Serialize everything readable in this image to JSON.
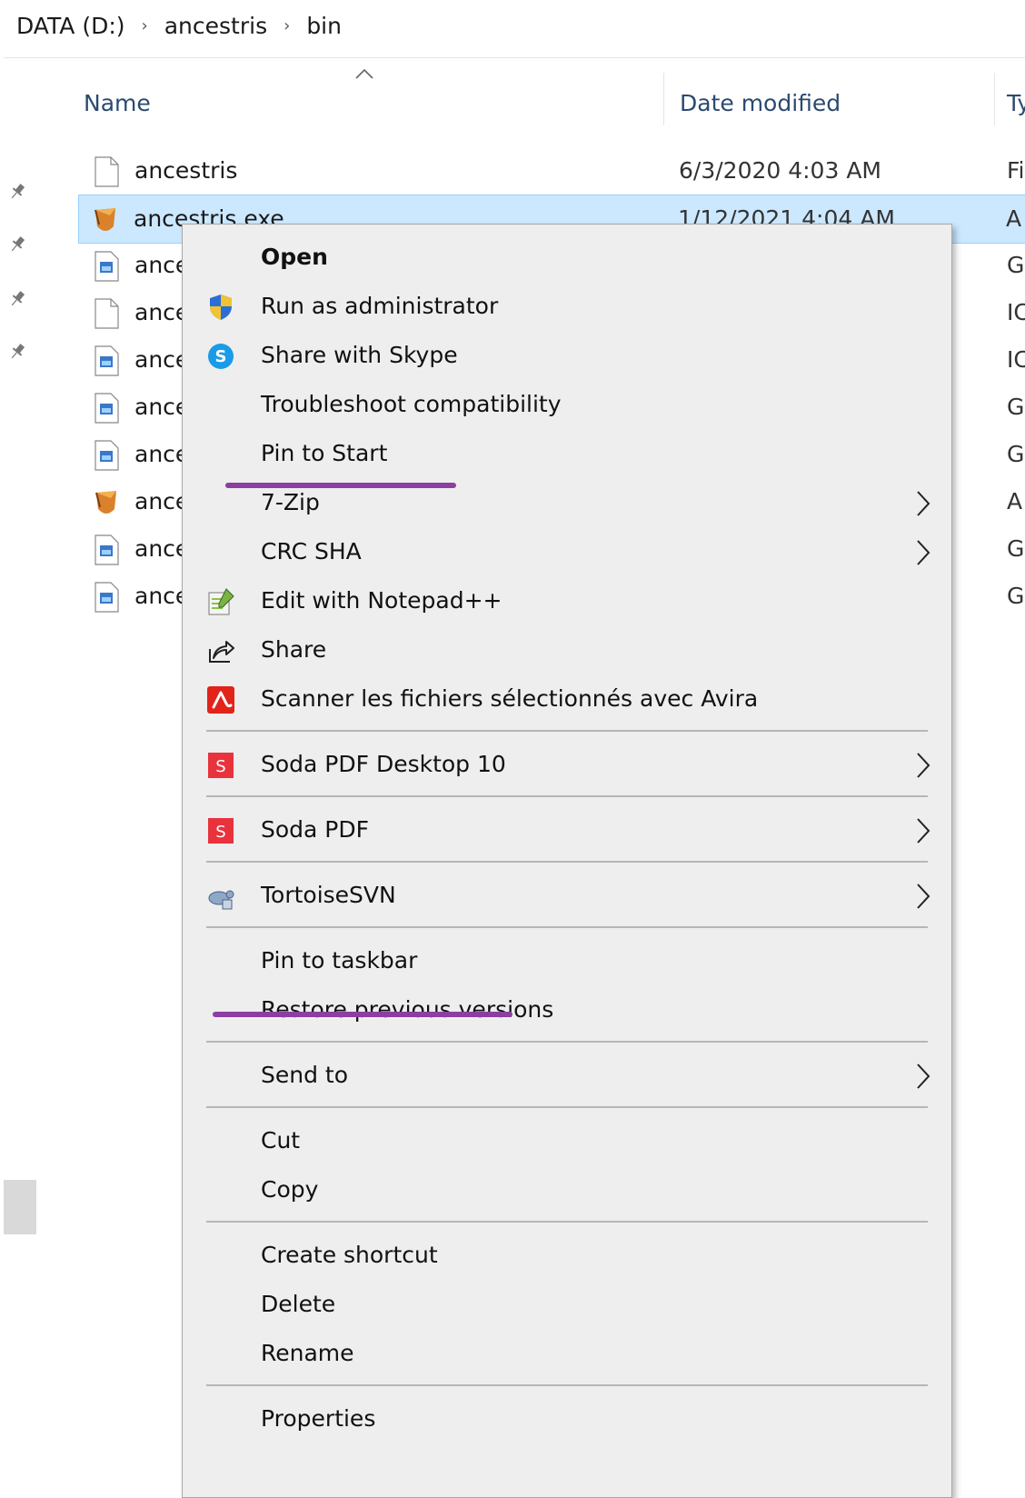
{
  "breadcrumb": [
    "DATA (D:)",
    "ancestris",
    "bin"
  ],
  "columns": {
    "name": "Name",
    "date_modified": "Date modified",
    "type": "Ty"
  },
  "files": [
    {
      "name": "ancestris",
      "date": "6/3/2020 4:03 AM",
      "type": "Fi",
      "icon": "blank-file-icon"
    },
    {
      "name": "ancestris.exe",
      "date": "1/12/2021 4:04 AM",
      "type": "A",
      "icon": "app-icon",
      "selected": true
    },
    {
      "name": "ance",
      "date": "",
      "type": "G",
      "icon": "image-file-icon"
    },
    {
      "name": "ance",
      "date": "",
      "type": "IC",
      "icon": "blank-file-icon"
    },
    {
      "name": "ance",
      "date": "",
      "type": "IC",
      "icon": "image-file-icon"
    },
    {
      "name": "ance",
      "date": "",
      "type": "G",
      "icon": "image-file-icon"
    },
    {
      "name": "ance",
      "date": "",
      "type": "G",
      "icon": "image-file-icon"
    },
    {
      "name": "ance",
      "date": "",
      "type": "A",
      "icon": "app-icon"
    },
    {
      "name": "ance",
      "date": "",
      "type": "G",
      "icon": "image-file-icon"
    },
    {
      "name": "ance",
      "date": "",
      "type": "G",
      "icon": "image-file-icon"
    }
  ],
  "context_menu": {
    "open": "Open",
    "run_as_admin": "Run as administrator",
    "share_skype": "Share with Skype",
    "troubleshoot": "Troubleshoot compatibility",
    "pin_start": "Pin to Start",
    "seven_zip": "7-Zip",
    "crc_sha": "CRC SHA",
    "edit_notepad": "Edit with Notepad++",
    "share": "Share",
    "avira": "Scanner les fichiers sélectionnés avec Avira",
    "soda_desktop": "Soda PDF Desktop 10",
    "soda_pdf": "Soda PDF",
    "tortoise": "TortoiseSVN",
    "pin_taskbar": "Pin to taskbar",
    "restore": "Restore previous versions",
    "send_to": "Send to",
    "cut": "Cut",
    "copy": "Copy",
    "create_shortcut": "Create shortcut",
    "delete": "Delete",
    "rename": "Rename",
    "properties": "Properties"
  },
  "colors": {
    "selection": "#cce8ff",
    "annotation": "#8b3fa0",
    "menu_bg": "#eeeeee"
  }
}
